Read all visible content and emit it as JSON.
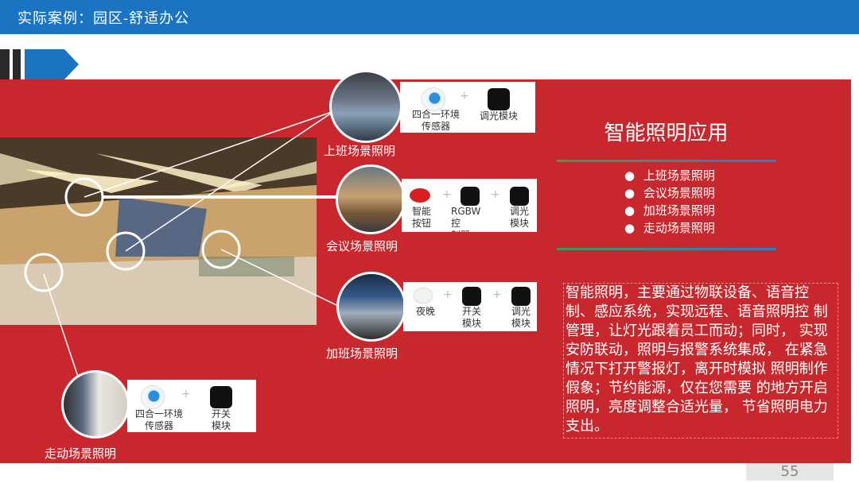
{
  "header": {
    "title": "实际案例：园区-舒适办公"
  },
  "app_title": "智能照明应用",
  "bullets": [
    "上班场景照明",
    "会议场景照明",
    "加班场景照明",
    "走动场景照明"
  ],
  "description": "智能照明，主要通过物联设备、语音控 制、感应系统，实现远程、语音照明控 制管理，让灯光跟着员工而动；同时， 实现安防联动，照明与报警系统集成， 在紧急情况下打开警报灯，离开时模拟 照明制作假象；节约能源，仅在您需要 的地方开启照明，亮度调整合适光量， 节省照明电力支出。",
  "scenes": {
    "work": {
      "label": "上班场景照明",
      "dev1": "四合一环境\n传感器",
      "dev2": "调光模块"
    },
    "meeting": {
      "label": "会议场景照明",
      "dev1": "智能\n按钮",
      "dev2": "RGBW\n控\n制器",
      "dev3": "调光\n模块"
    },
    "overtime": {
      "label": "加班场景照明",
      "dev1": "夜晚",
      "dev2": "开关\n模块",
      "dev3": "调光\n模块"
    },
    "walk": {
      "label": "走动场景照明",
      "dev1": "四合一环境\n传感器",
      "dev2": "开关\n模块"
    }
  },
  "plus_sign": "+",
  "page_number": "55"
}
